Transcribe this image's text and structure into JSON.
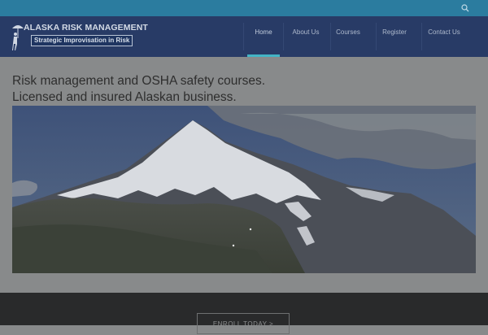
{
  "brand": {
    "title": "ALASKA RISK MANAGEMENT",
    "tagline": "Strategic Improvisation in Risk"
  },
  "nav": {
    "items": [
      {
        "label": "Home",
        "active": true
      },
      {
        "label": "About Us",
        "active": false
      },
      {
        "label": "Courses",
        "active": false
      },
      {
        "label": "Register",
        "active": false
      },
      {
        "label": "Contact Us",
        "active": false
      }
    ]
  },
  "hero": {
    "line1": "Risk management and OSHA safety courses.",
    "line2": "Licensed and insured Alaskan business."
  },
  "cta": {
    "label": "ENROLL TODAY  >"
  },
  "colors": {
    "topbar": "#2b7c9f",
    "navbar": "#283b66",
    "accent": "#43b5c6",
    "page_bg": "#888a8b",
    "footer": "#292a2b"
  },
  "icons": {
    "search": "search-icon",
    "logo": "umbrella-icon"
  }
}
